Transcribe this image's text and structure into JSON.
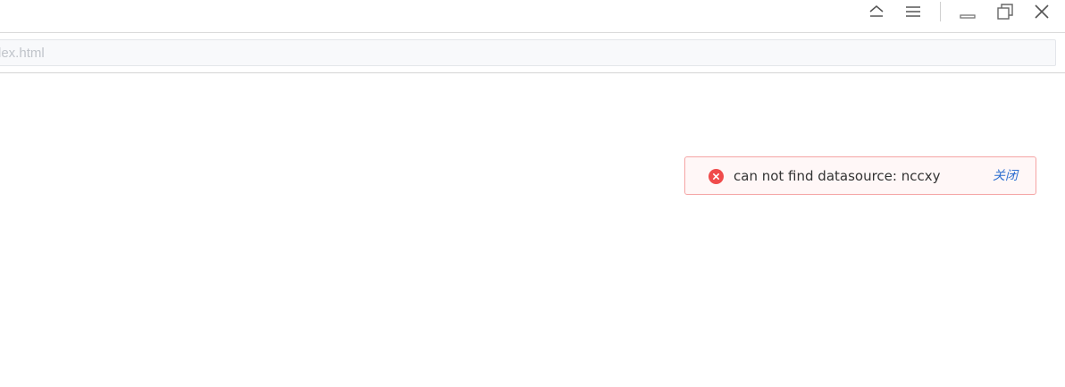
{
  "window": {
    "controls": {
      "collapse_icon": "chevron-up-icon",
      "menu_icon": "hamburger-menu-icon",
      "minimize_icon": "minimize-icon",
      "restore_icon": "restore-icon",
      "close_icon": "close-icon"
    }
  },
  "address_bar": {
    "value": "dex.html"
  },
  "toast": {
    "message": "can not find datasource: nccxy",
    "close_label": "关闭",
    "icon": "error-circle-icon",
    "colors": {
      "border": "#f5a5a5",
      "background": "#fff7f7",
      "icon": "#f04b4b",
      "link": "#2f6fd0"
    }
  }
}
